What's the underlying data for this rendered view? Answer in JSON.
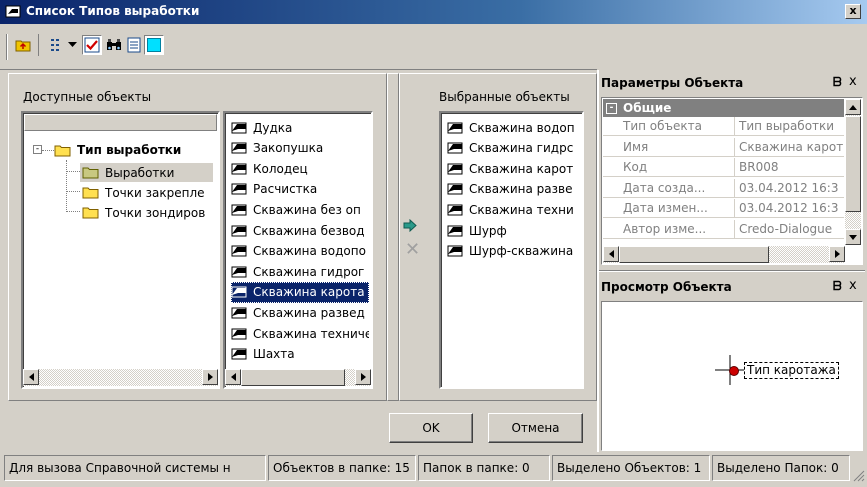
{
  "window": {
    "title": "Список Типов выработки",
    "close_label": "x"
  },
  "toolbar": {
    "icons": [
      "folder-up-icon",
      "view-list-icon",
      "dropdown-icon",
      "check-icon",
      "binoculars-icon",
      "document-icon",
      "color-box-icon"
    ]
  },
  "left_panel": {
    "label": "Доступные объекты"
  },
  "tree": {
    "root": "Тип выработки",
    "children": [
      "Выработки",
      "Точки закрепле",
      "Точки зондиров"
    ]
  },
  "available_list": {
    "items": [
      "Дудка",
      "Закопушка",
      "Колодец",
      "Расчистка",
      "Скважина без оп",
      "Скважина безвод",
      "Скважина водопо",
      "Скважина гидрог",
      "Скважина карота",
      "Скважина развед",
      "Скважина техниче",
      "Шахта"
    ],
    "selected_index": 8
  },
  "selected_panel": {
    "label": "Выбранные объекты",
    "items": [
      "Скважина водоп",
      "Скважина гидрс",
      "Скважина карот",
      "Скважина разве",
      "Скважина техни",
      "Шурф",
      "Шурф-скважина"
    ]
  },
  "buttons": {
    "ok": "OK",
    "cancel": "Отмена"
  },
  "params_pane": {
    "title": "Параметры Объекта",
    "pin": "ᗷ",
    "close": "x",
    "group": "Общие",
    "rows": [
      {
        "key": "Тип объекта",
        "value": "Тип выработки"
      },
      {
        "key": "Имя",
        "value": "Скважина карот"
      },
      {
        "key": "Код",
        "value": "BR008"
      },
      {
        "key": "Дата созда...",
        "value": "03.04.2012 16:3"
      },
      {
        "key": "Дата измен...",
        "value": "03.04.2012 16:3"
      },
      {
        "key": "Автор изме...",
        "value": "Credo-Dialogue"
      }
    ]
  },
  "preview_pane": {
    "title": "Просмотр Объекта",
    "pin": "ᗷ",
    "close": "x",
    "symbol_label": "Тип каротажа"
  },
  "status_bar": {
    "help": "Для вызова Справочной системы н",
    "objects_in_folder": "Объектов в папке: 15",
    "folders_in_folder": "Папок в папке: 0",
    "selected_objects": "Выделено Объектов: 1",
    "selected_folders": "Выделено Папок: 0"
  },
  "colors": {
    "title_bar": "#0a246a",
    "selection": "#0a246a",
    "face": "#d4d0c8",
    "preview_marker": "#cc0000"
  }
}
